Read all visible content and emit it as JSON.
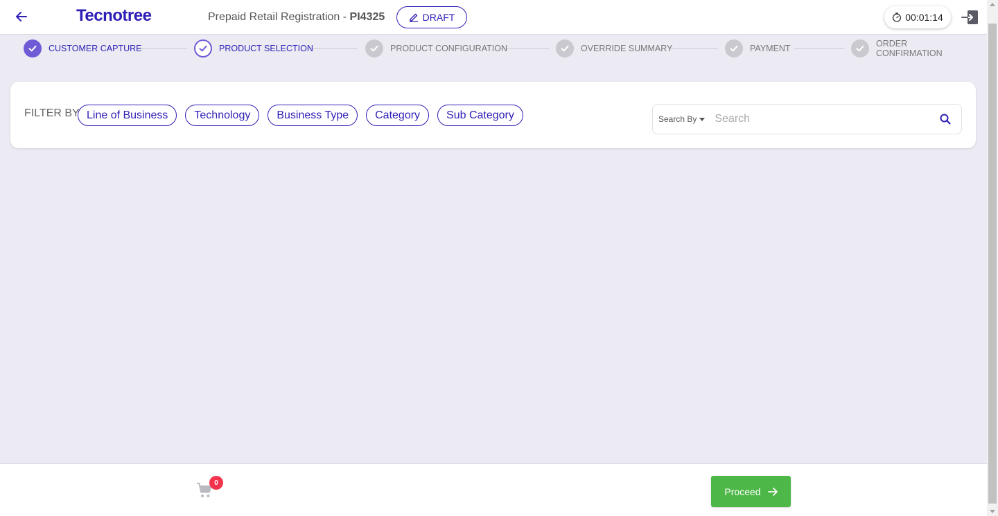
{
  "header": {
    "logo": "Tecnotree",
    "title_prefix": "Prepaid Retail Registration - ",
    "title_id": "PI4325",
    "draft_label": "DRAFT",
    "timer": "00:01:14"
  },
  "stepper": {
    "steps": [
      {
        "label": "CUSTOMER CAPTURE",
        "status": "done"
      },
      {
        "label": "PRODUCT SELECTION",
        "status": "active"
      },
      {
        "label": "PRODUCT CONFIGURATION",
        "status": "pending"
      },
      {
        "label": "OVERRIDE SUMMARY",
        "status": "pending"
      },
      {
        "label": "PAYMENT",
        "status": "pending"
      },
      {
        "label": "ORDER CONFIRMATION",
        "status": "pending"
      }
    ]
  },
  "filter": {
    "label": "FILTER BY",
    "chips": [
      "Line of Business",
      "Technology",
      "Business Type",
      "Category",
      "Sub Category"
    ],
    "search_by": "Search By",
    "search_placeholder": "Search"
  },
  "footer": {
    "cart_count": "0",
    "proceed_label": "Proceed"
  },
  "colors": {
    "brand": "#2d1fb5",
    "step_done": "#6f5bd6",
    "proceed": "#4db748",
    "badge": "#f2344d",
    "background": "#ecebf4"
  }
}
